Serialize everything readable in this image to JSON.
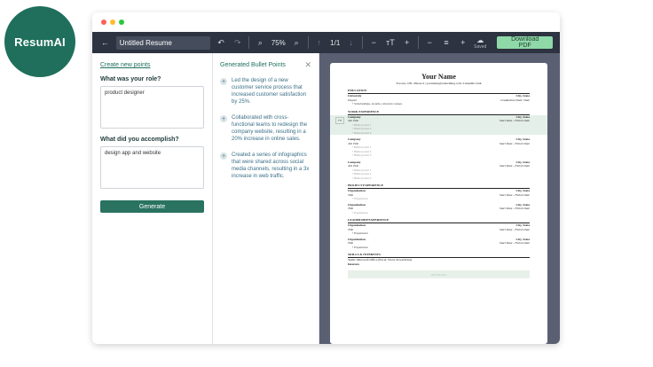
{
  "brand": {
    "name": "ResumAI"
  },
  "toolbar": {
    "title_value": "Untitled Resume",
    "zoom": "75%",
    "page": "1/1",
    "saved_label": "Saved",
    "download_label": "Download PDF"
  },
  "left": {
    "create_link": "Create new points",
    "role_q": "What was your role?",
    "role_value": "product designer",
    "accomplish_q": "What did you accomplish?",
    "accomplish_value": "design app and website",
    "generate_label": "Generate"
  },
  "middle": {
    "title": "Generated Bullet Points",
    "bullets": [
      "Led the design of a new customer service process that increased customer satisfaction by 25%.",
      "Collaborated with cross-functional teams to redesign the company website, resulting in a 20% increase in online sales.",
      "Created a series of infographics that were shared across social media channels, resulting in a 3x increase in web traffic."
    ]
  },
  "resume": {
    "name": "Your Name",
    "contact": "Toronto, ON | Phone # | yourname@ronnelding.com | LinkedIn Link",
    "education_h": "EDUCATION",
    "university": "University",
    "city_state": "City, State",
    "degree": "Degree",
    "grad_date": "Graduation Date: Date",
    "edu_bullet": "Scholarships, awards, relevant courses",
    "work_h": "WORK EXPERIENCE",
    "company": "Company",
    "job_title": "Job Title",
    "dates": "Start Date - Finish Date",
    "bp1": "Bullet point 1",
    "bp2": "Bullet point 2",
    "bp3": "Bullet point 3",
    "project_h": "PROJECT EXPERIENCE",
    "organization": "Organization",
    "title": "Title",
    "experience": "Experience",
    "leadership_h": "LEADERSHIP EXPERIENCE",
    "skills_h": "SKILLS & INTERESTS",
    "skills_line": "Skills: Microsoft Office (Excel, Word, PowerPoint)",
    "interests": "Interests",
    "add_section": "Add Section"
  },
  "colors": {
    "accent": "#2a7361",
    "toolbar": "#2d3340",
    "download": "#8fd9a8"
  }
}
